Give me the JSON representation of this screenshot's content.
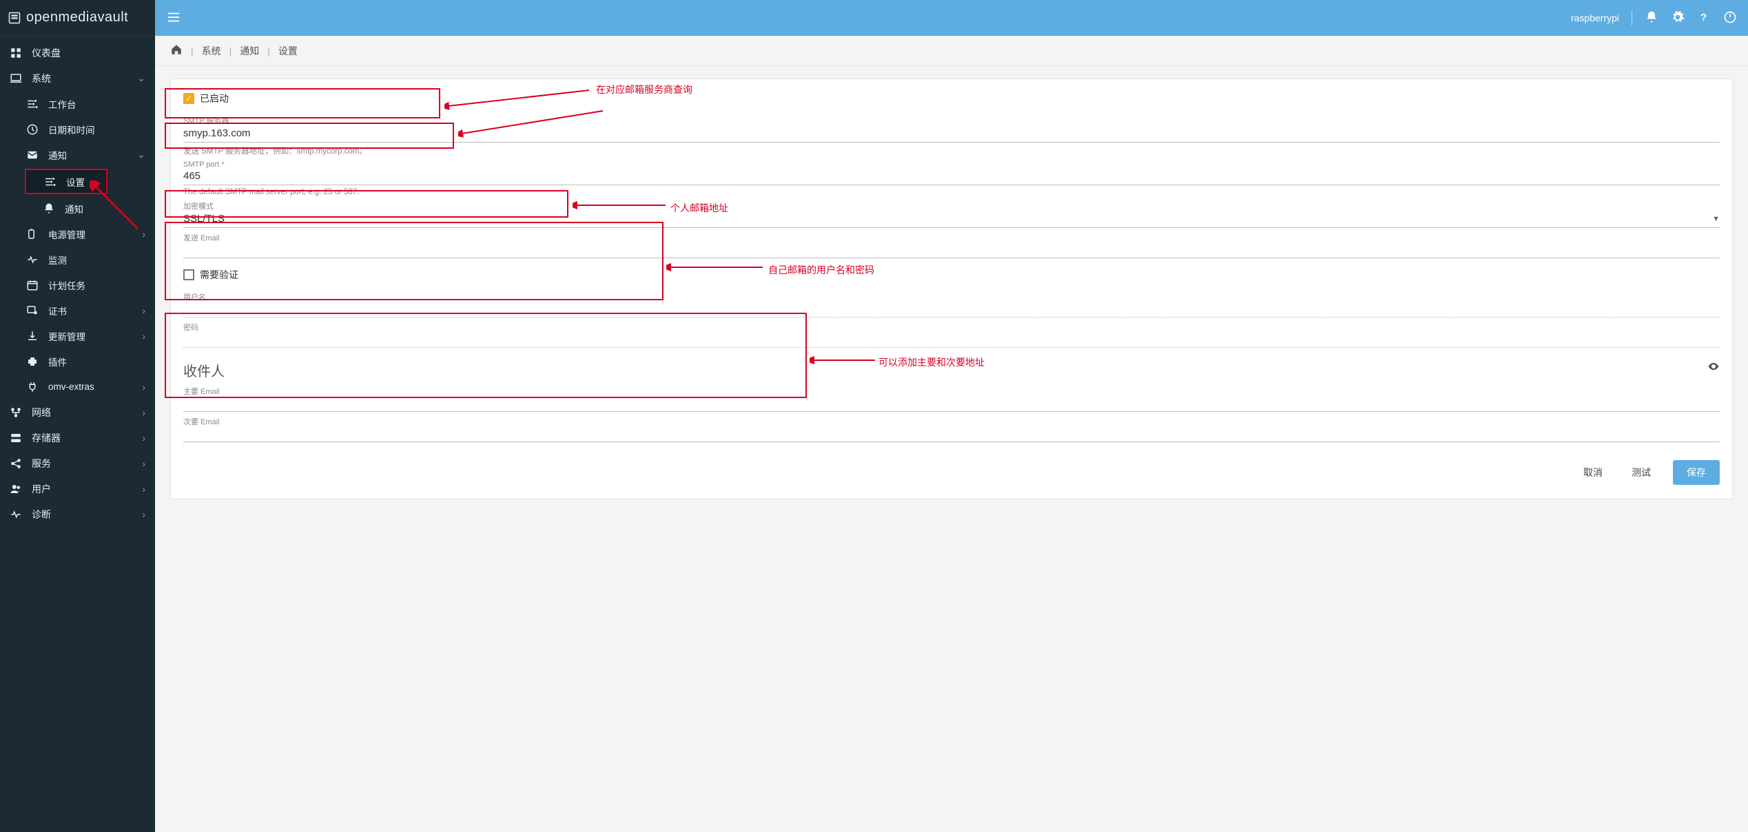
{
  "brand": "openmediavault",
  "topbar": {
    "host": "raspberrypi"
  },
  "crumbs": {
    "c1": "系统",
    "c2": "通知",
    "c3": "设置"
  },
  "sidebar": {
    "dashboard": "仪表盘",
    "system": "系统",
    "workbench": "工作台",
    "datetime": "日期和时间",
    "notify": "通知",
    "settings": "设置",
    "notify2": "通知",
    "power": "电源管理",
    "monitor": "监测",
    "schedule": "计划任务",
    "cert": "证书",
    "update": "更新管理",
    "plugins": "插件",
    "omv": "omv-extras",
    "network": "网络",
    "storage": "存储器",
    "services": "服务",
    "users": "用户",
    "diag": "诊断"
  },
  "form": {
    "enabled_label": "已启动",
    "smtp_server_label": "SMTP 服务器",
    "smtp_server_value": "smyp.163.com",
    "smtp_server_help": "发送 SMTP 服务器地址，例如：smtp.mycorp.com。",
    "smtp_port_label": "SMTP port *",
    "smtp_port_value": "465",
    "smtp_port_help": "The default SMTP mail server port, e.g. 25 or 587.",
    "enc_label": "加密模式",
    "enc_value": "SSL/TLS",
    "send_email_label": "发送 Email",
    "send_email_value": "",
    "auth_label": "需要验证",
    "user_label": "用户名",
    "user_value": "",
    "pass_label": "密码",
    "pass_value": "",
    "recipient_title": "收件人",
    "primary_label": "主要 Email",
    "primary_value": "",
    "secondary_label": "次要 Email",
    "secondary_value": ""
  },
  "actions": {
    "cancel": "取消",
    "test": "测试",
    "save": "保存"
  },
  "anno": {
    "a1": "在对应邮箱服务商查询",
    "a2": "个人邮箱地址",
    "a3": "自己邮箱的用户名和密码",
    "a4": "可以添加主要和次要地址"
  }
}
